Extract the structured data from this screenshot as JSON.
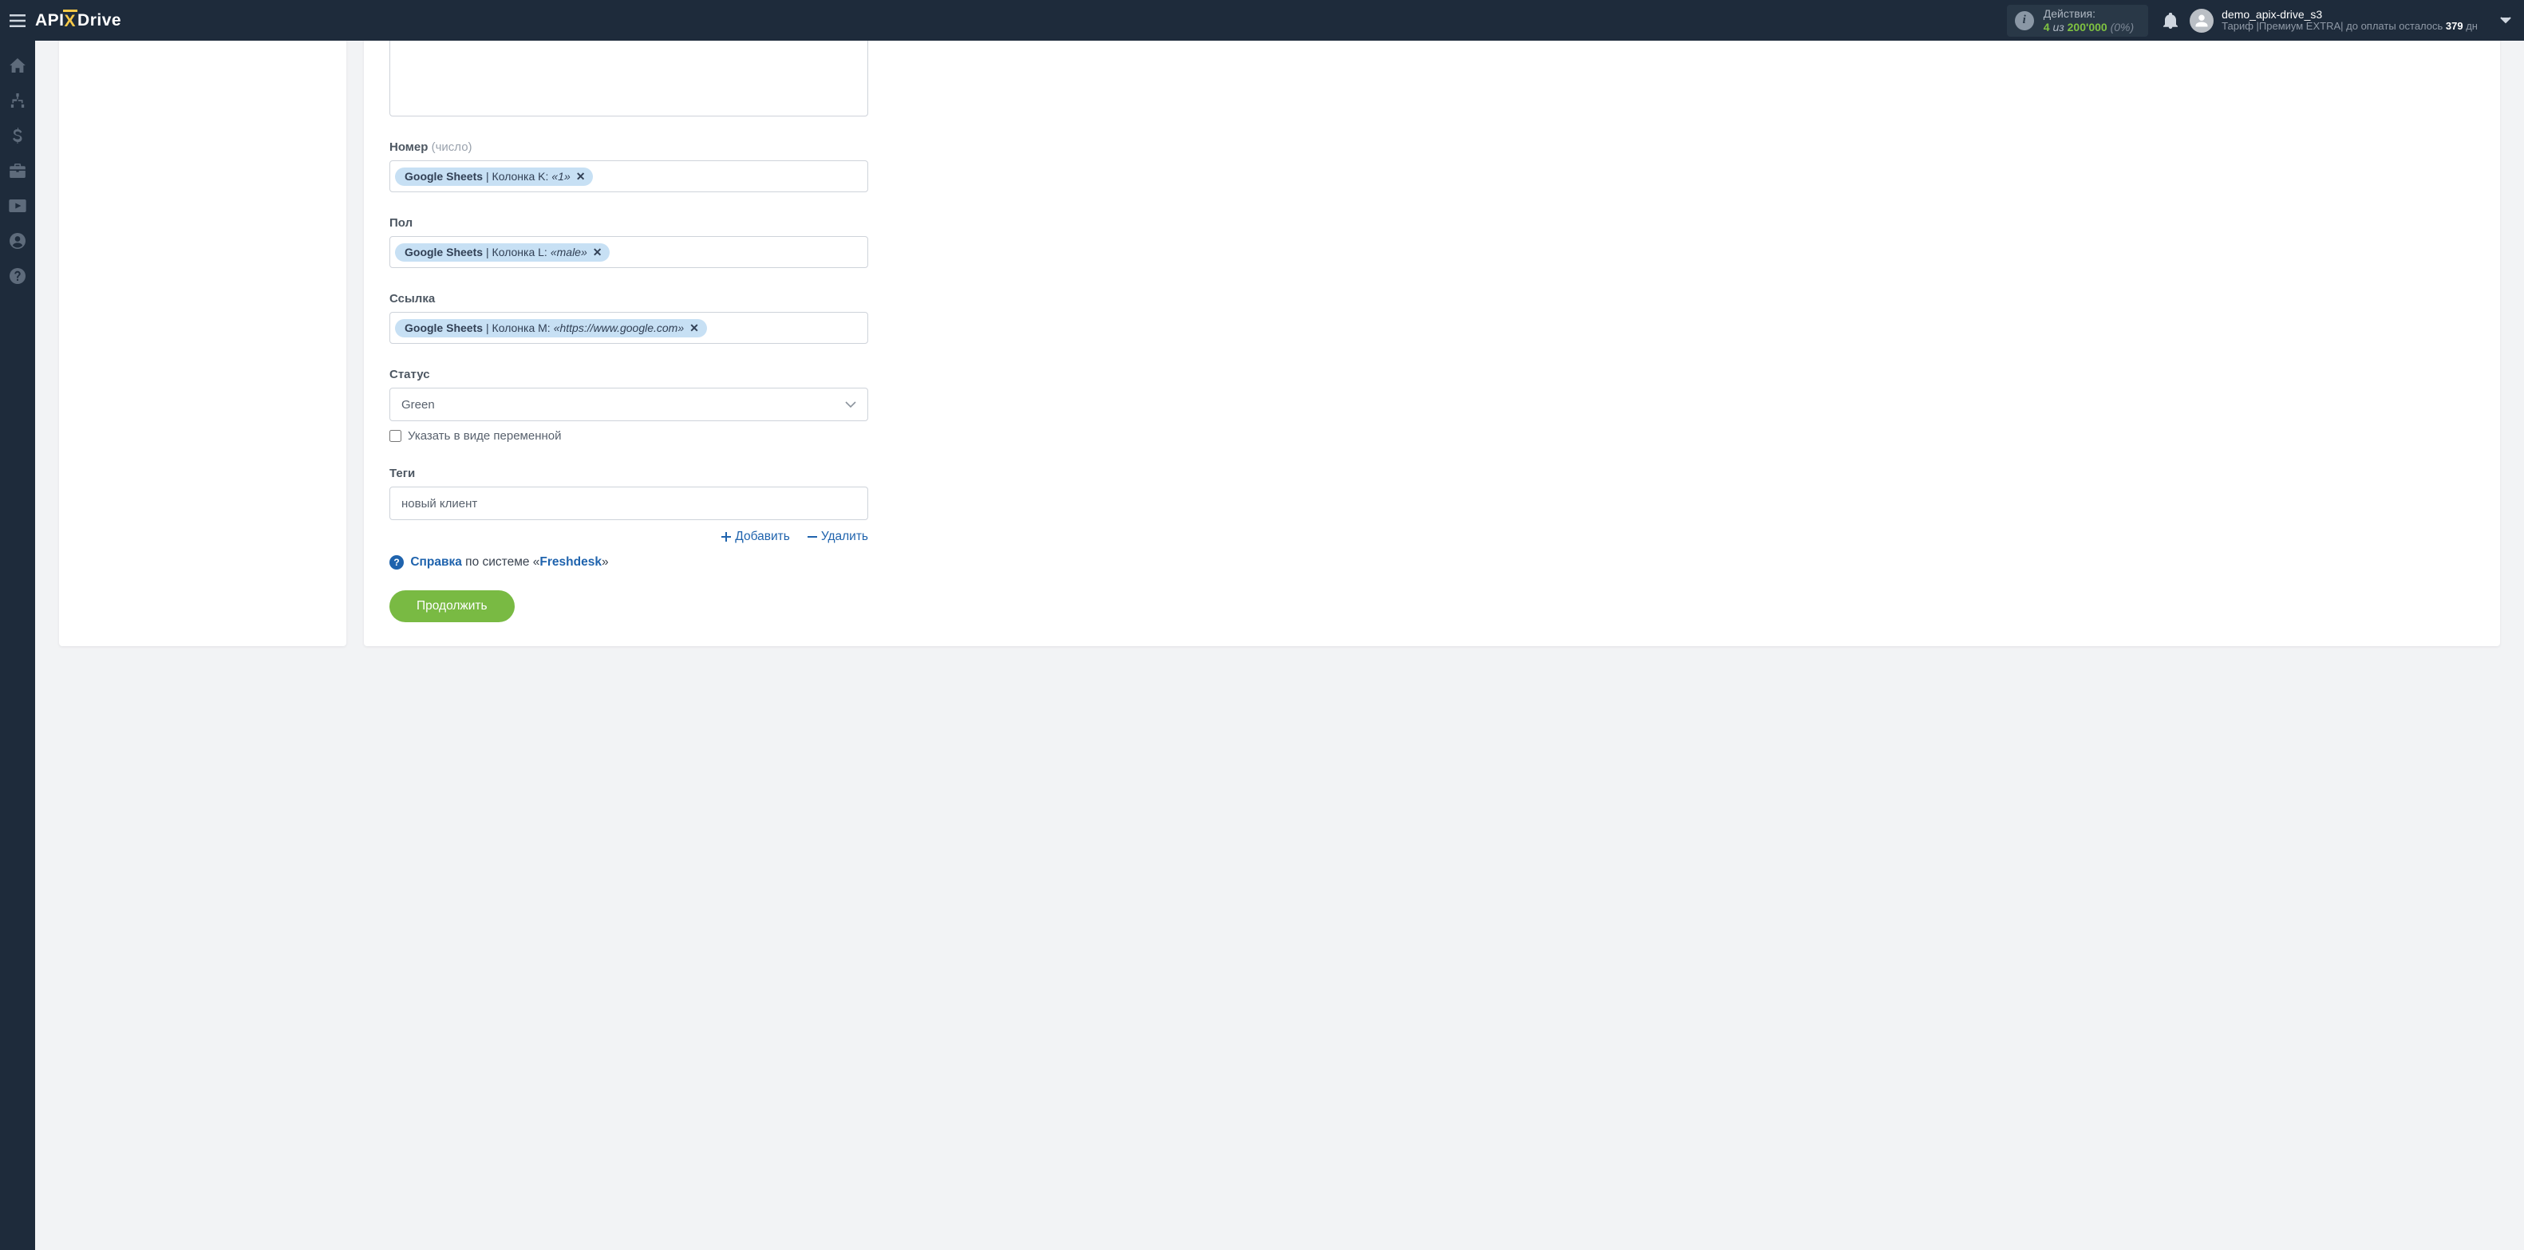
{
  "header": {
    "logo": {
      "part1": "API",
      "part2": "X",
      "part3": "Drive"
    },
    "actions": {
      "title": "Действия:",
      "used": "4",
      "of_word": "из",
      "limit": "200'000",
      "percent": "(0%)"
    },
    "user": {
      "name": "demo_apix-drive_s3",
      "tariff_prefix": "Тариф |",
      "tariff_name": "Премиум EXTRA",
      "tariff_sep": "|",
      "remaining_prefix": " до оплаты осталось ",
      "remaining_days": "379",
      "remaining_unit": " дн"
    }
  },
  "form": {
    "number": {
      "label": "Номер",
      "hint": "(число)",
      "token": {
        "source": "Google Sheets",
        "column": " | Колонка K: ",
        "value": "«1»"
      }
    },
    "gender": {
      "label": "Пол",
      "token": {
        "source": "Google Sheets",
        "column": " | Колонка L: ",
        "value": "«male»"
      }
    },
    "link": {
      "label": "Ссылка",
      "token": {
        "source": "Google Sheets",
        "column": " | Колонка M: ",
        "value": "«https://www.google.com»"
      }
    },
    "status": {
      "label": "Статус",
      "selected": "Green",
      "checkbox_label": "Указать в виде переменной"
    },
    "tags": {
      "label": "Теги",
      "value": "новый клиент"
    },
    "actions": {
      "add": "Добавить",
      "remove": "Удалить"
    },
    "help": {
      "link_text": "Справка",
      "middle": " по системе «",
      "system": "Freshdesk",
      "end": "»"
    },
    "continue": "Продолжить"
  }
}
